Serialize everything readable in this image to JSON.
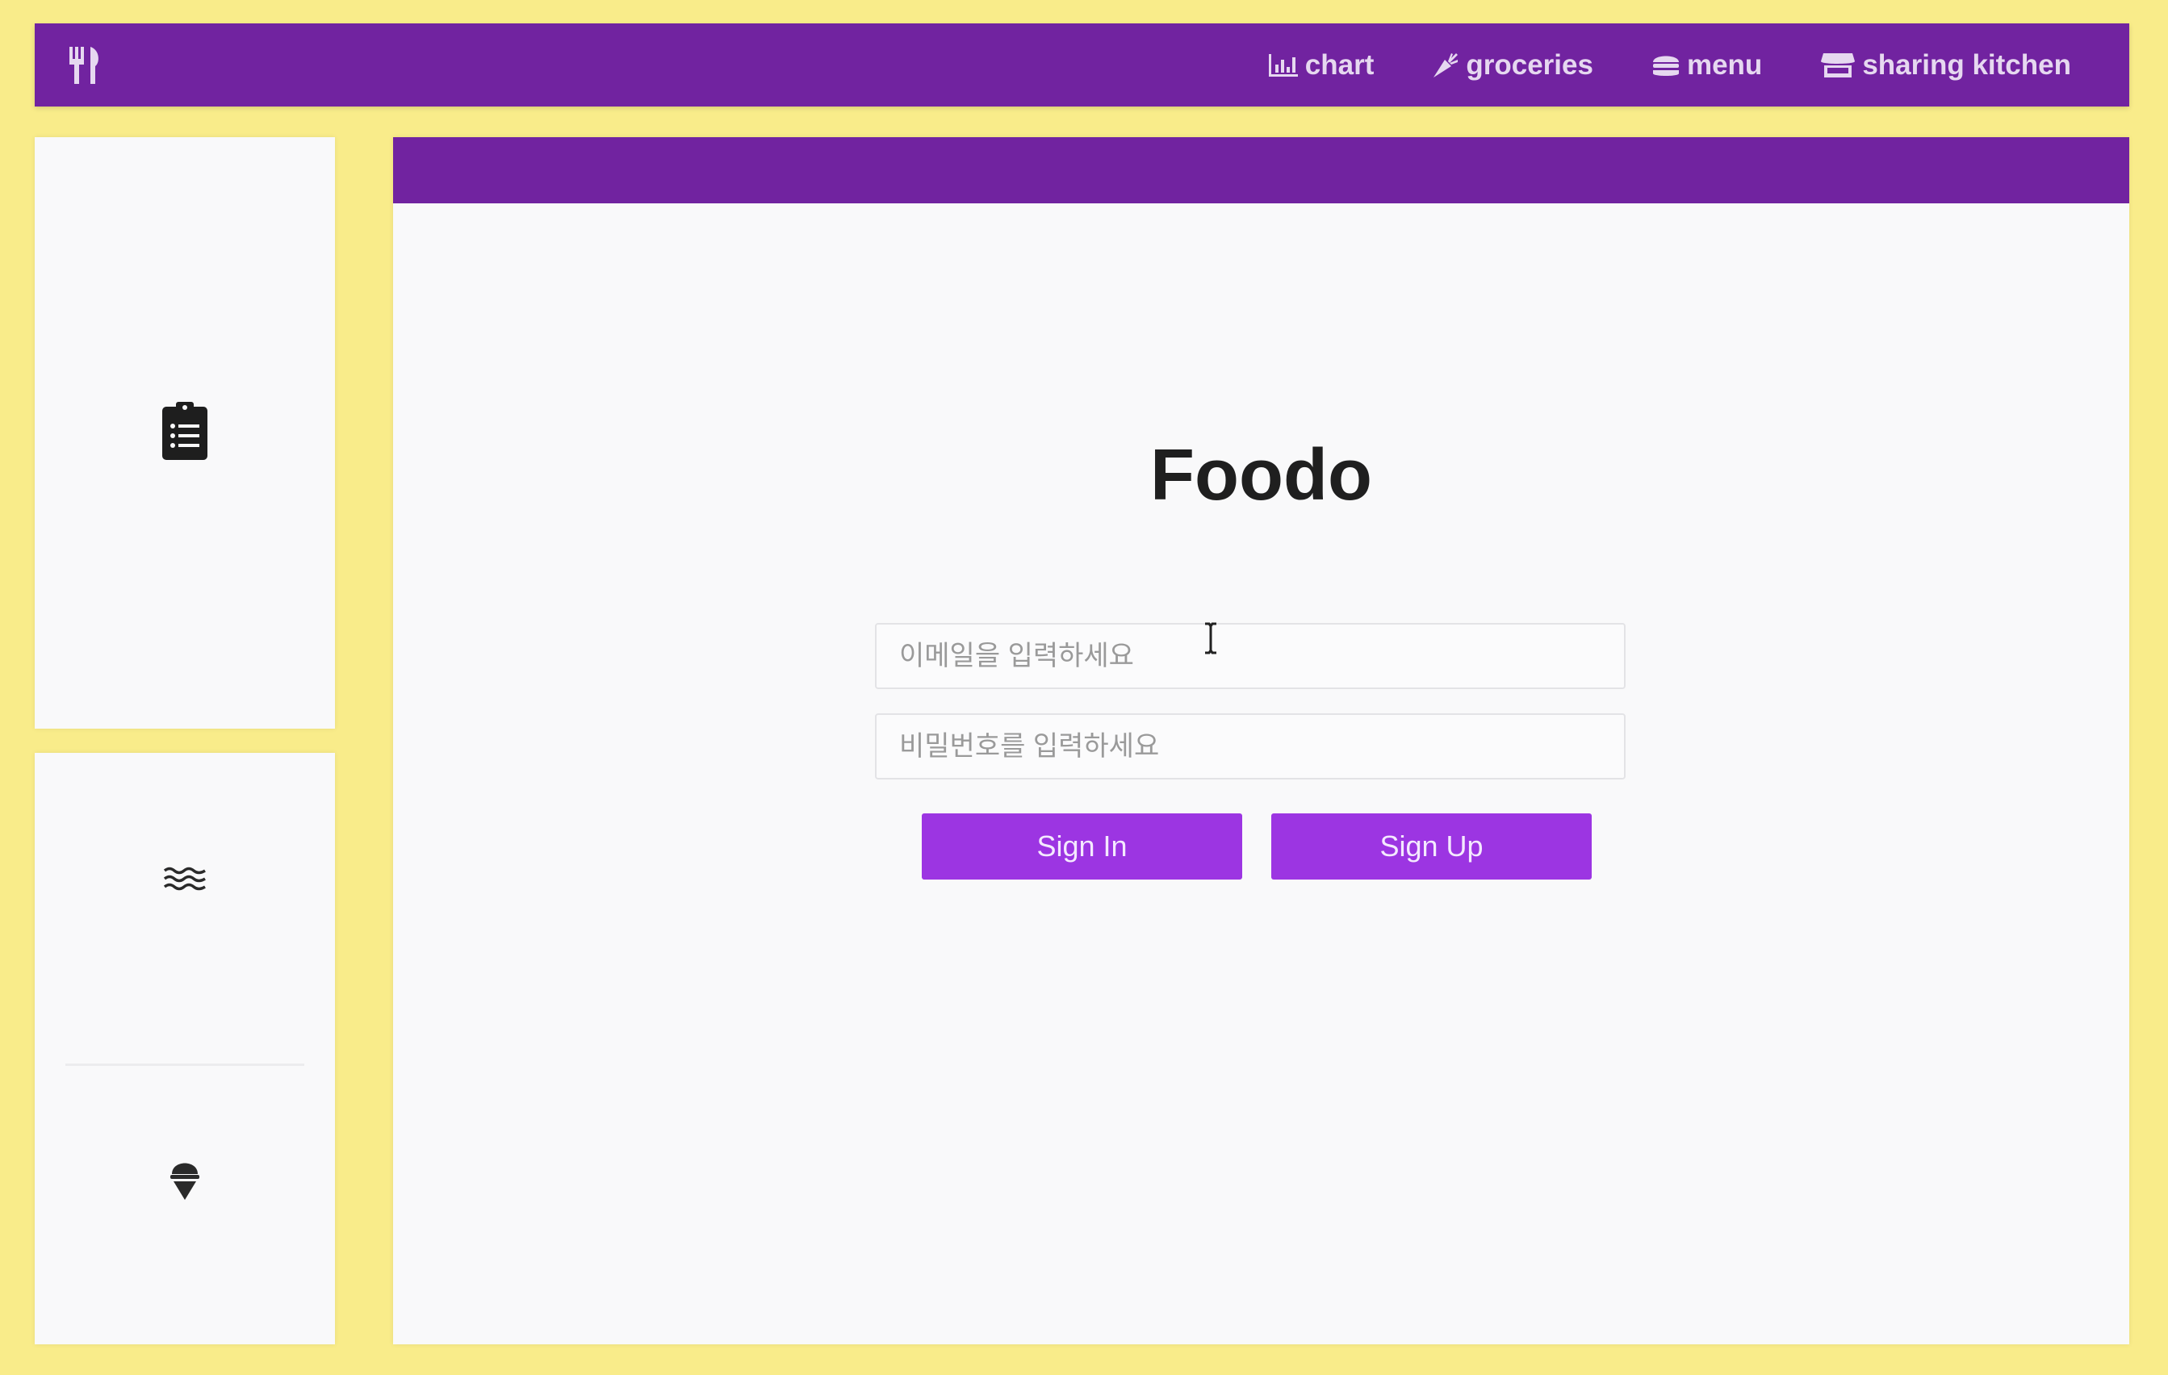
{
  "nav": {
    "brand_icon": "utensils-icon",
    "items": [
      {
        "label": "chart",
        "icon": "chart-icon"
      },
      {
        "label": "groceries",
        "icon": "carrot-icon"
      },
      {
        "label": "menu",
        "icon": "hamburger-icon"
      },
      {
        "label": "sharing kitchen",
        "icon": "store-icon"
      }
    ]
  },
  "sidebar": {
    "icons": [
      "clipboard-list-icon",
      "water-waves-icon",
      "ice-cream-icon"
    ]
  },
  "main": {
    "title": "Foodo",
    "email_placeholder": "이메일을 입력하세요",
    "password_placeholder": "비밀번호를 입력하세요",
    "signin_label": "Sign In",
    "signup_label": "Sign Up"
  },
  "colors": {
    "background": "#f9ec8a",
    "nav": "#7123a0",
    "button": "#9c35e2"
  }
}
